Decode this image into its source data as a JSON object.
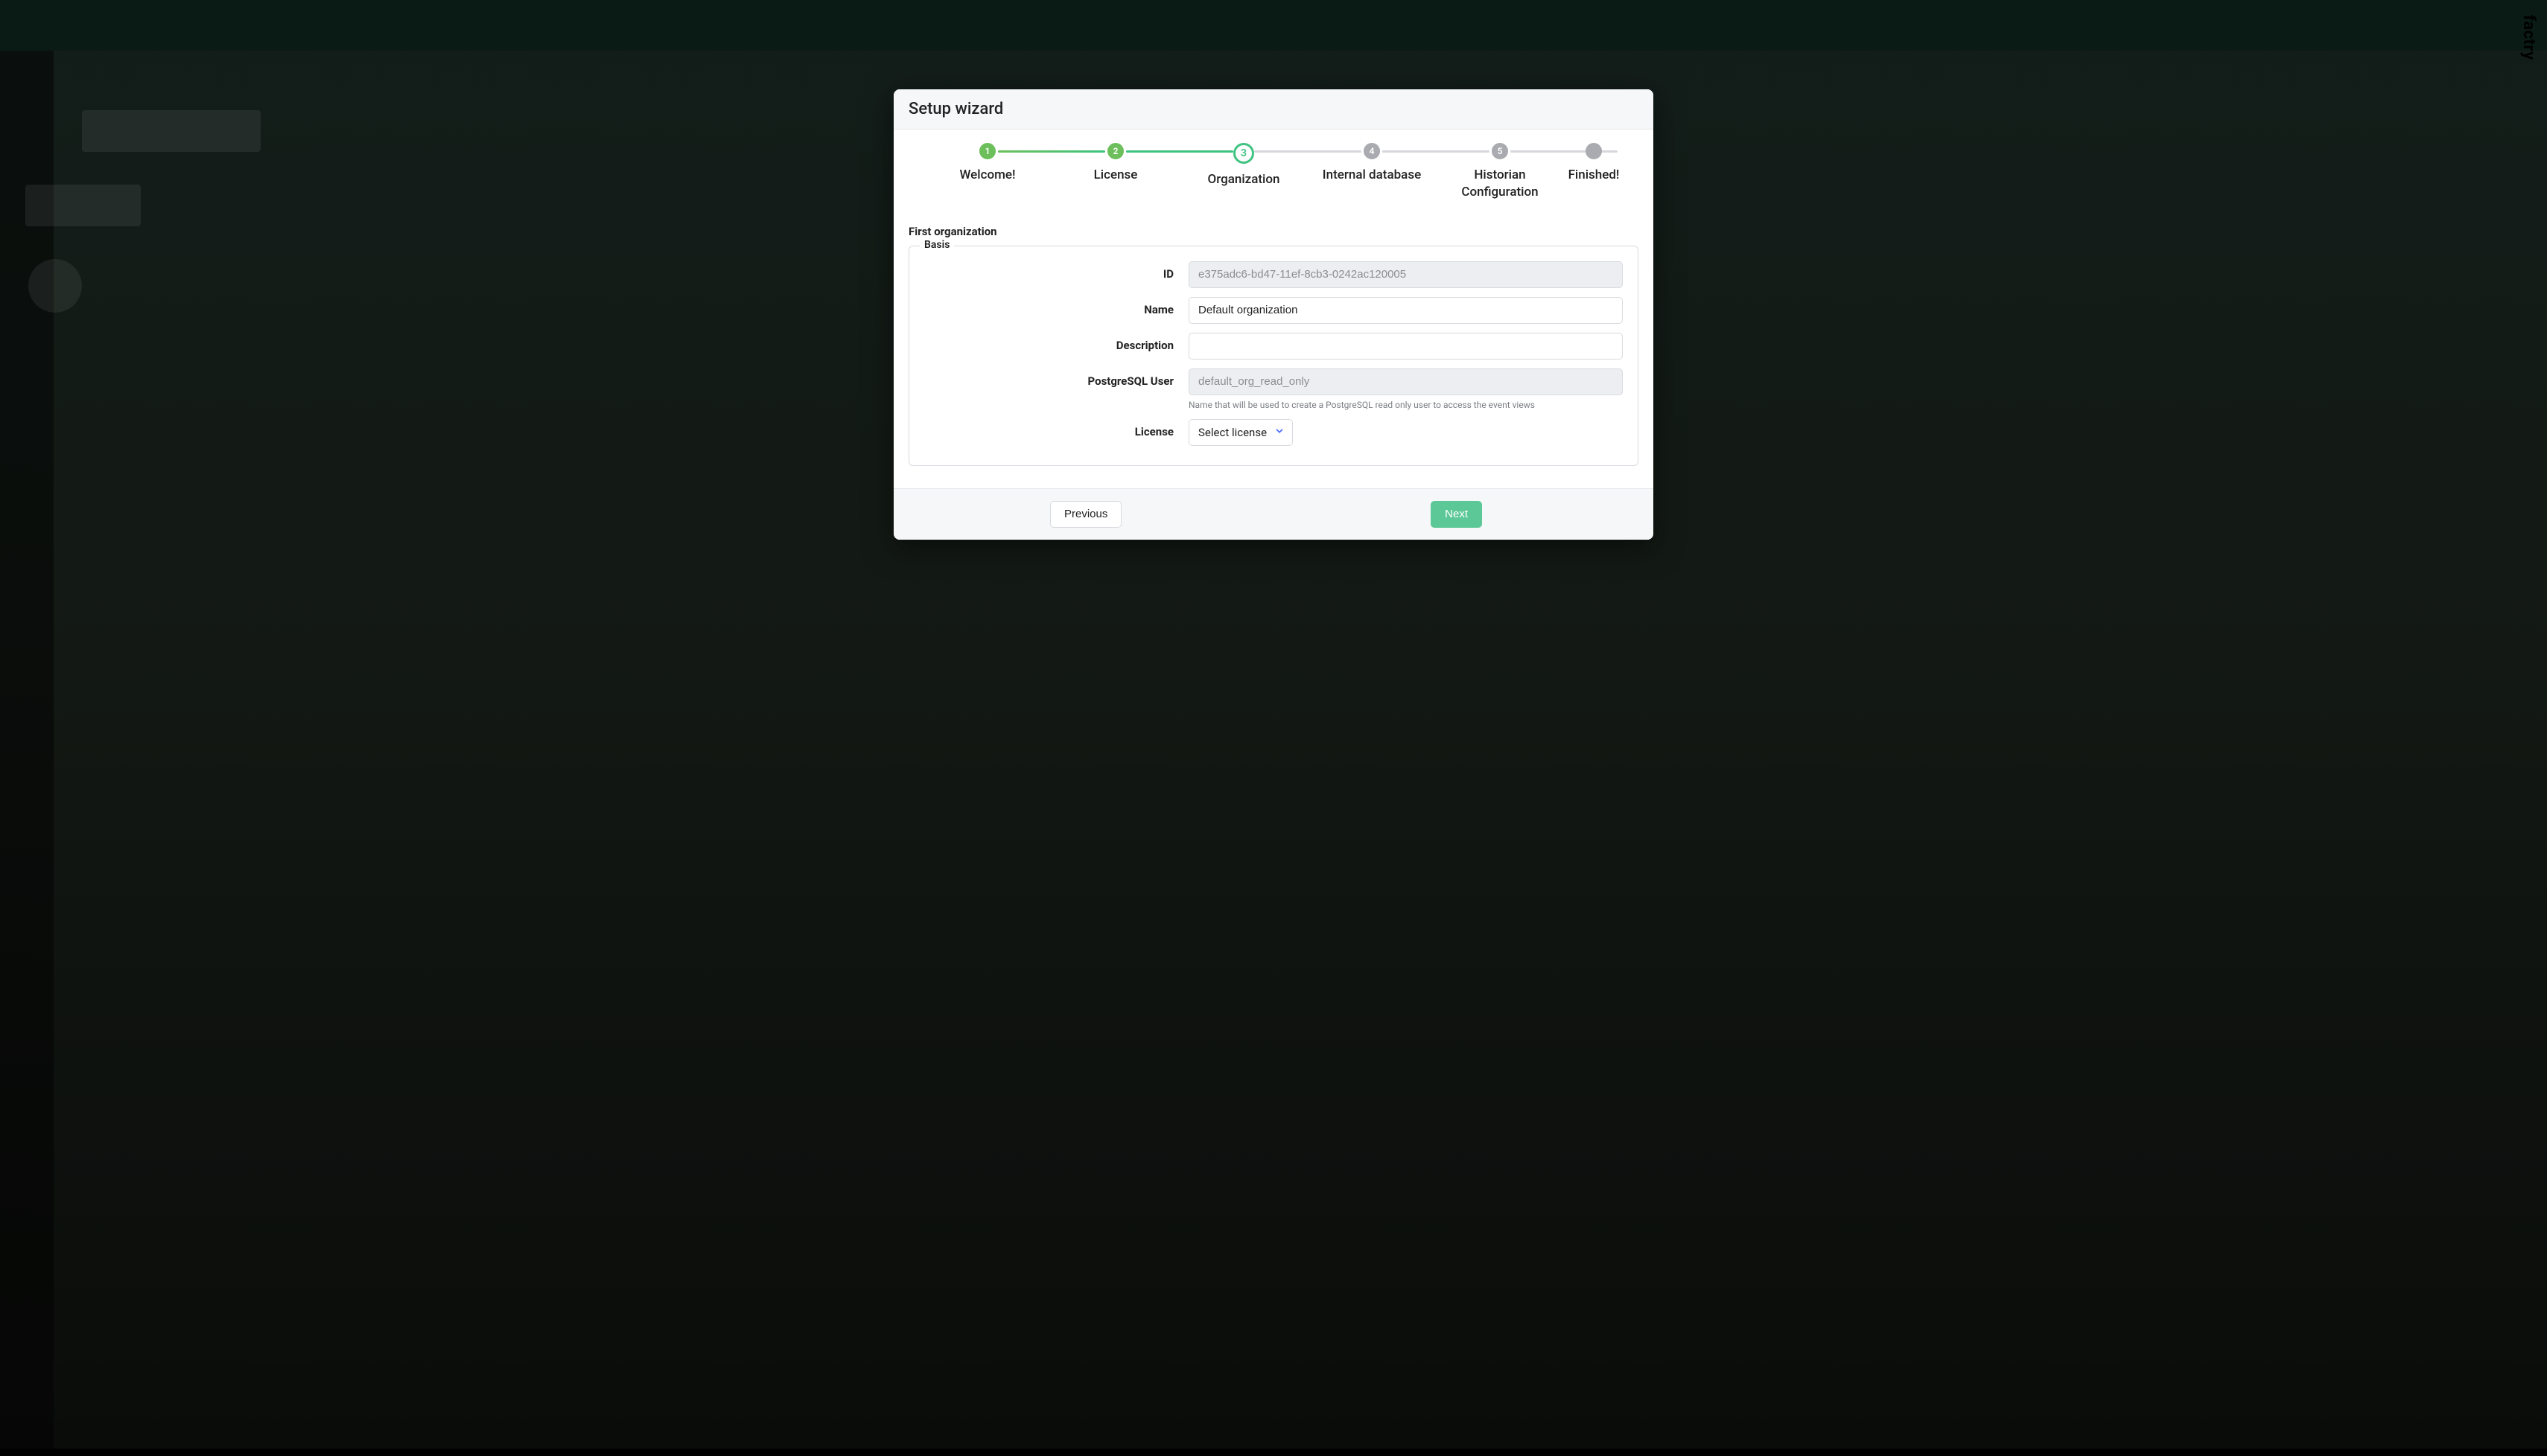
{
  "brand": "factry",
  "modal": {
    "title": "Setup wizard",
    "steps": [
      {
        "number": "1",
        "label": "Welcome!",
        "state": "done"
      },
      {
        "number": "2",
        "label": "License",
        "state": "done"
      },
      {
        "number": "3",
        "label": "Organization",
        "state": "active"
      },
      {
        "number": "4",
        "label": "Internal database",
        "state": "upcoming"
      },
      {
        "number": "5",
        "label": "Historian\nConfiguration",
        "state": "upcoming"
      },
      {
        "number": "",
        "label": "Finished!",
        "state": "last"
      }
    ],
    "section_title": "First organization",
    "fieldset_legend": "Basis",
    "form": {
      "id": {
        "label": "ID",
        "value": "e375adc6-bd47-11ef-8cb3-0242ac120005"
      },
      "name": {
        "label": "Name",
        "value": "Default organization"
      },
      "description": {
        "label": "Description",
        "value": ""
      },
      "pg_user": {
        "label": "PostgreSQL User",
        "value": "default_org_read_only",
        "help": "Name that will be used to create a PostgreSQL read only user to access the event views"
      },
      "license": {
        "label": "License",
        "selected": "Select license"
      }
    },
    "footer": {
      "previous": "Previous",
      "next": "Next"
    }
  }
}
